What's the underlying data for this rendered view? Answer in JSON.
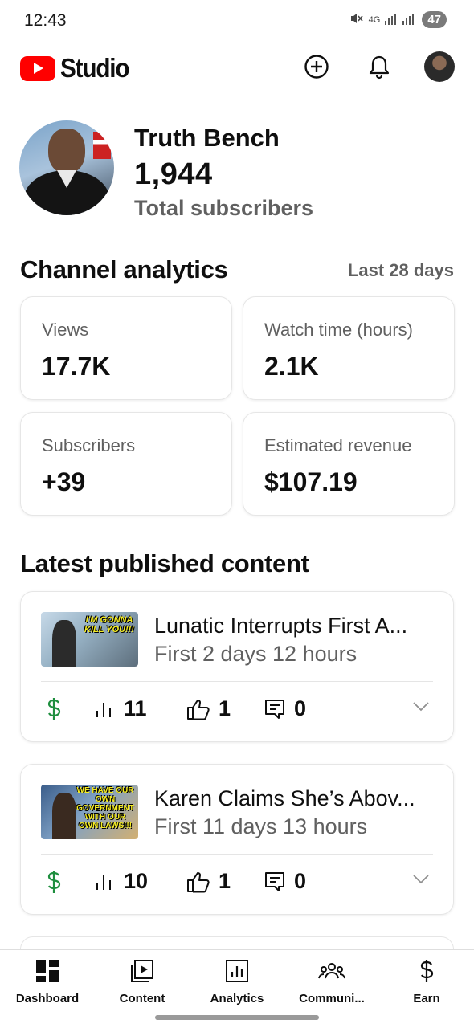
{
  "status_bar": {
    "time": "12:43",
    "network": "4G",
    "battery": "47"
  },
  "app": {
    "logo_text": "Studio"
  },
  "channel": {
    "name": "Truth Bench",
    "subscribers": "1,944",
    "subscribers_label": "Total subscribers"
  },
  "analytics": {
    "title": "Channel analytics",
    "period": "Last 28 days",
    "cards": [
      {
        "label": "Views",
        "value": "17.7K"
      },
      {
        "label": "Watch time (hours)",
        "value": "2.1K"
      },
      {
        "label": "Subscribers",
        "value": "+39"
      },
      {
        "label": "Estimated revenue",
        "value": "$107.19"
      }
    ]
  },
  "latest": {
    "title": "Latest published content",
    "videos": [
      {
        "title": "Lunatic Interrupts First A...",
        "subtitle": "First 2 days 12 hours",
        "thumb_text": "I'M GONNA KILL YOU!!!",
        "views": "11",
        "likes": "1",
        "comments": "0"
      },
      {
        "title": "Karen Claims She’s Abov...",
        "subtitle": "First 11 days 13 hours",
        "thumb_text": "WE HAVE OUR OWN GOVERNMENT WITH OUR OWN LAWS!!!",
        "views": "10",
        "likes": "1",
        "comments": "0"
      }
    ]
  },
  "nav": {
    "items": [
      {
        "label": "Dashboard",
        "icon": "dashboard-icon"
      },
      {
        "label": "Content",
        "icon": "content-icon"
      },
      {
        "label": "Analytics",
        "icon": "analytics-icon"
      },
      {
        "label": "Communi...",
        "icon": "community-icon"
      },
      {
        "label": "Earn",
        "icon": "earn-icon"
      }
    ]
  },
  "colors": {
    "brand_red": "#ff0000",
    "money_green": "#1e8e3e",
    "secondary_text": "#606060"
  }
}
